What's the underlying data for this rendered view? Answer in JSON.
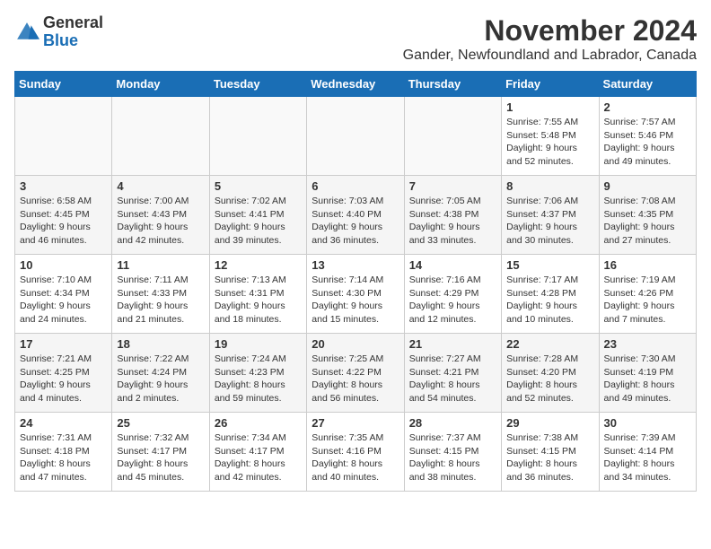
{
  "header": {
    "logo_general": "General",
    "logo_blue": "Blue",
    "month_title": "November 2024",
    "location": "Gander, Newfoundland and Labrador, Canada"
  },
  "weekdays": [
    "Sunday",
    "Monday",
    "Tuesday",
    "Wednesday",
    "Thursday",
    "Friday",
    "Saturday"
  ],
  "weeks": [
    [
      {
        "day": "",
        "info": ""
      },
      {
        "day": "",
        "info": ""
      },
      {
        "day": "",
        "info": ""
      },
      {
        "day": "",
        "info": ""
      },
      {
        "day": "",
        "info": ""
      },
      {
        "day": "1",
        "info": "Sunrise: 7:55 AM\nSunset: 5:48 PM\nDaylight: 9 hours and 52 minutes."
      },
      {
        "day": "2",
        "info": "Sunrise: 7:57 AM\nSunset: 5:46 PM\nDaylight: 9 hours and 49 minutes."
      }
    ],
    [
      {
        "day": "3",
        "info": "Sunrise: 6:58 AM\nSunset: 4:45 PM\nDaylight: 9 hours and 46 minutes."
      },
      {
        "day": "4",
        "info": "Sunrise: 7:00 AM\nSunset: 4:43 PM\nDaylight: 9 hours and 42 minutes."
      },
      {
        "day": "5",
        "info": "Sunrise: 7:02 AM\nSunset: 4:41 PM\nDaylight: 9 hours and 39 minutes."
      },
      {
        "day": "6",
        "info": "Sunrise: 7:03 AM\nSunset: 4:40 PM\nDaylight: 9 hours and 36 minutes."
      },
      {
        "day": "7",
        "info": "Sunrise: 7:05 AM\nSunset: 4:38 PM\nDaylight: 9 hours and 33 minutes."
      },
      {
        "day": "8",
        "info": "Sunrise: 7:06 AM\nSunset: 4:37 PM\nDaylight: 9 hours and 30 minutes."
      },
      {
        "day": "9",
        "info": "Sunrise: 7:08 AM\nSunset: 4:35 PM\nDaylight: 9 hours and 27 minutes."
      }
    ],
    [
      {
        "day": "10",
        "info": "Sunrise: 7:10 AM\nSunset: 4:34 PM\nDaylight: 9 hours and 24 minutes."
      },
      {
        "day": "11",
        "info": "Sunrise: 7:11 AM\nSunset: 4:33 PM\nDaylight: 9 hours and 21 minutes."
      },
      {
        "day": "12",
        "info": "Sunrise: 7:13 AM\nSunset: 4:31 PM\nDaylight: 9 hours and 18 minutes."
      },
      {
        "day": "13",
        "info": "Sunrise: 7:14 AM\nSunset: 4:30 PM\nDaylight: 9 hours and 15 minutes."
      },
      {
        "day": "14",
        "info": "Sunrise: 7:16 AM\nSunset: 4:29 PM\nDaylight: 9 hours and 12 minutes."
      },
      {
        "day": "15",
        "info": "Sunrise: 7:17 AM\nSunset: 4:28 PM\nDaylight: 9 hours and 10 minutes."
      },
      {
        "day": "16",
        "info": "Sunrise: 7:19 AM\nSunset: 4:26 PM\nDaylight: 9 hours and 7 minutes."
      }
    ],
    [
      {
        "day": "17",
        "info": "Sunrise: 7:21 AM\nSunset: 4:25 PM\nDaylight: 9 hours and 4 minutes."
      },
      {
        "day": "18",
        "info": "Sunrise: 7:22 AM\nSunset: 4:24 PM\nDaylight: 9 hours and 2 minutes."
      },
      {
        "day": "19",
        "info": "Sunrise: 7:24 AM\nSunset: 4:23 PM\nDaylight: 8 hours and 59 minutes."
      },
      {
        "day": "20",
        "info": "Sunrise: 7:25 AM\nSunset: 4:22 PM\nDaylight: 8 hours and 56 minutes."
      },
      {
        "day": "21",
        "info": "Sunrise: 7:27 AM\nSunset: 4:21 PM\nDaylight: 8 hours and 54 minutes."
      },
      {
        "day": "22",
        "info": "Sunrise: 7:28 AM\nSunset: 4:20 PM\nDaylight: 8 hours and 52 minutes."
      },
      {
        "day": "23",
        "info": "Sunrise: 7:30 AM\nSunset: 4:19 PM\nDaylight: 8 hours and 49 minutes."
      }
    ],
    [
      {
        "day": "24",
        "info": "Sunrise: 7:31 AM\nSunset: 4:18 PM\nDaylight: 8 hours and 47 minutes."
      },
      {
        "day": "25",
        "info": "Sunrise: 7:32 AM\nSunset: 4:17 PM\nDaylight: 8 hours and 45 minutes."
      },
      {
        "day": "26",
        "info": "Sunrise: 7:34 AM\nSunset: 4:17 PM\nDaylight: 8 hours and 42 minutes."
      },
      {
        "day": "27",
        "info": "Sunrise: 7:35 AM\nSunset: 4:16 PM\nDaylight: 8 hours and 40 minutes."
      },
      {
        "day": "28",
        "info": "Sunrise: 7:37 AM\nSunset: 4:15 PM\nDaylight: 8 hours and 38 minutes."
      },
      {
        "day": "29",
        "info": "Sunrise: 7:38 AM\nSunset: 4:15 PM\nDaylight: 8 hours and 36 minutes."
      },
      {
        "day": "30",
        "info": "Sunrise: 7:39 AM\nSunset: 4:14 PM\nDaylight: 8 hours and 34 minutes."
      }
    ]
  ]
}
